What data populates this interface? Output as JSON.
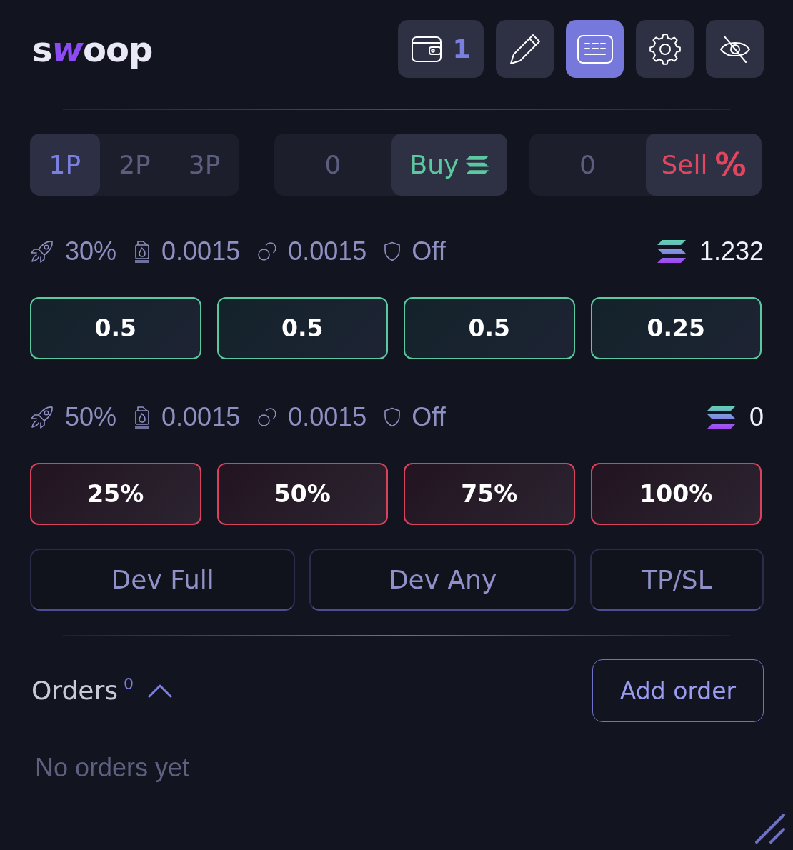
{
  "header": {
    "logo": {
      "lead": "s",
      "accent": "w",
      "tail": "oop"
    },
    "toolbar": [
      {
        "kind": "wallet",
        "count": "1",
        "selected": false
      },
      {
        "kind": "edit",
        "selected": false
      },
      {
        "kind": "keyboard",
        "selected": true
      },
      {
        "kind": "settings",
        "selected": false
      },
      {
        "kind": "hide",
        "selected": false
      }
    ]
  },
  "presets": [
    {
      "label": "1P",
      "selected": true
    },
    {
      "label": "2P",
      "selected": false
    },
    {
      "label": "3P",
      "selected": false
    }
  ],
  "buy": {
    "placeholder": "0",
    "button": "Buy"
  },
  "sell": {
    "placeholder": "0",
    "button": "Sell",
    "glyph": "%"
  },
  "buy_stats": {
    "items": [
      {
        "kind": "rocket",
        "value": "30%"
      },
      {
        "kind": "gas",
        "value": "0.0015"
      },
      {
        "kind": "rings",
        "value": "0.0015"
      },
      {
        "kind": "shield",
        "value": "Off"
      }
    ],
    "balance": "1.232"
  },
  "buy_amounts": [
    "0.5",
    "0.5",
    "0.5",
    "0.25"
  ],
  "sell_stats": {
    "items": [
      {
        "kind": "rocket",
        "value": "50%"
      },
      {
        "kind": "gas",
        "value": "0.0015"
      },
      {
        "kind": "rings",
        "value": "0.0015"
      },
      {
        "kind": "shield",
        "value": "Off"
      }
    ],
    "balance": "0"
  },
  "sell_amounts": [
    "25%",
    "50%",
    "75%",
    "100%"
  ],
  "actions": [
    "Dev Full",
    "Dev Any",
    "TP/SL"
  ],
  "orders": {
    "title": "Orders",
    "count": "0",
    "expanded": true,
    "add_button": "Add order",
    "empty_text": "No orders yet"
  }
}
